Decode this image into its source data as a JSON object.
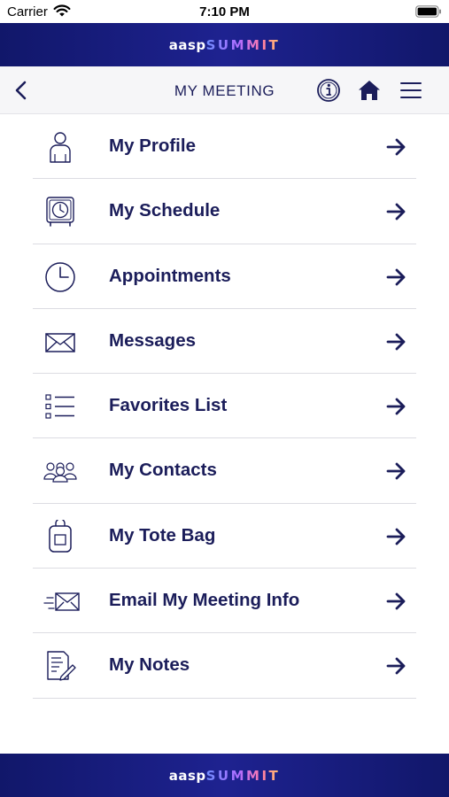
{
  "status_bar": {
    "carrier": "Carrier",
    "time": "7:10 PM"
  },
  "brand": {
    "part_a": "aasp",
    "part_b": "SUMMIT"
  },
  "nav": {
    "title": "MY MEETING",
    "icons": {
      "back": "chevron-left-icon",
      "info": "info-icon",
      "home": "home-icon",
      "menu": "hamburger-menu-icon"
    }
  },
  "menu": {
    "items": [
      {
        "label": "My Profile",
        "icon": "person-icon"
      },
      {
        "label": "My Schedule",
        "icon": "alarm-clock-icon"
      },
      {
        "label": "Appointments",
        "icon": "clock-icon"
      },
      {
        "label": "Messages",
        "icon": "envelope-icon"
      },
      {
        "label": "Favorites List",
        "icon": "checklist-icon"
      },
      {
        "label": "My Contacts",
        "icon": "group-icon"
      },
      {
        "label": "My Tote Bag",
        "icon": "tote-bag-icon"
      },
      {
        "label": "Email My Meeting Info",
        "icon": "send-mail-icon"
      },
      {
        "label": "My Notes",
        "icon": "notes-icon"
      }
    ]
  },
  "colors": {
    "brand_navy": "#1b1d5a",
    "brand_bar": "#11176a",
    "divider": "#dcdce2"
  }
}
